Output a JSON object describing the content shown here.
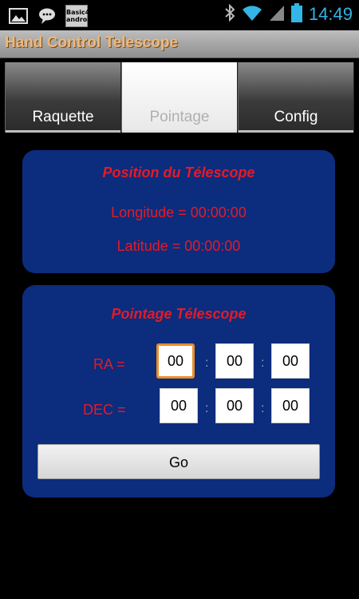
{
  "status_bar": {
    "icons": [
      "image-icon",
      "chat-bubble-icon",
      "basic-android-app-icon"
    ],
    "basic_icon_line1": "Basic4",
    "basic_icon_line2": "android",
    "right_icons": [
      "bluetooth-icon",
      "wifi-icon",
      "signal-icon",
      "battery-icon"
    ],
    "time": "14:49"
  },
  "app": {
    "title": "Hand Control Telescope"
  },
  "tabs": [
    {
      "label": "Raquette",
      "active": false
    },
    {
      "label": "Pointage",
      "active": true
    },
    {
      "label": "Config",
      "active": false
    }
  ],
  "position_panel": {
    "title": "Position du Télescope",
    "longitude": "Longitude = 00:00:00",
    "latitude": "Latitude = 00:00:00"
  },
  "pointing_panel": {
    "title": "Pointage Télescope",
    "ra_label": "RA =",
    "dec_label": "DEC =",
    "ra_values": [
      "00",
      "00",
      "00"
    ],
    "dec_values": [
      "00",
      "00",
      "00"
    ],
    "separator": ":",
    "go_label": "Go"
  },
  "colors": {
    "panel_bg": "#0c2c7d",
    "accent_red": "#e41b27",
    "clock_blue": "#33b5e5",
    "title_text": "#f0b87a",
    "focus_orange": "#e88f2a"
  }
}
